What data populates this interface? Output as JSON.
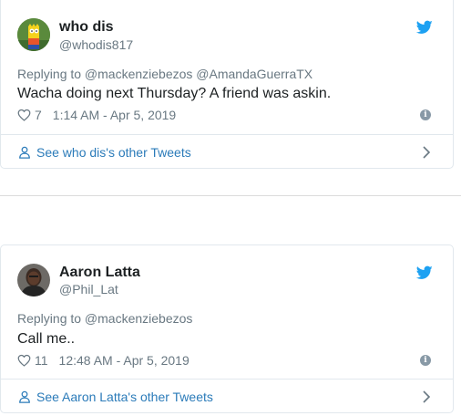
{
  "tweets": [
    {
      "name": "who dis",
      "handle": "@whodis817",
      "replying": "Replying to @mackenziebezos @AmandaGuerraTX",
      "text": "Wacha doing next Thursday? A friend was askin.",
      "likes": "7",
      "timestamp": "1:14 AM - Apr 5, 2019",
      "see_more": "See who dis's other Tweets",
      "avatar_icon": "bart-simpson-avatar"
    },
    {
      "name": "Aaron Latta",
      "handle": "@Phil_Lat",
      "replying": "Replying to @mackenziebezos",
      "text": "Call me..",
      "likes": "11",
      "timestamp": "12:48 AM - Apr 5, 2019",
      "see_more": "See Aaron Latta's other Tweets",
      "avatar_icon": "person-photo-avatar"
    }
  ],
  "icons": {
    "brand": "twitter-bird-icon",
    "like": "heart-icon",
    "info": "info-icon",
    "profile": "person-icon",
    "more": "chevron-right-icon"
  },
  "colors": {
    "twitter_blue": "#1da1f2",
    "link_blue": "#2b7bb9",
    "muted_gray": "#697882",
    "border": "#e1e8ed"
  }
}
